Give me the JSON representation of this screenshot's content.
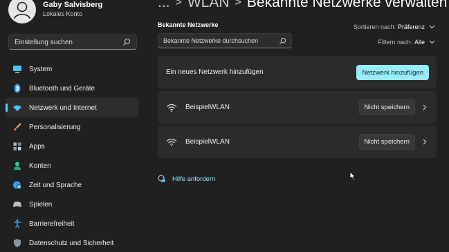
{
  "profile": {
    "name": "Gaby Salvisberg",
    "account_type": "Lokales Konto"
  },
  "sidebar": {
    "search_text": "Einstellung suchen",
    "items": [
      {
        "label": "System",
        "icon": "monitor-icon"
      },
      {
        "label": "Bluetooth und Geräte",
        "icon": "bluetooth-icon"
      },
      {
        "label": "Netzwerk und Internet",
        "icon": "wifi-network-icon",
        "active": true
      },
      {
        "label": "Personalisierung",
        "icon": "brush-icon"
      },
      {
        "label": "Apps",
        "icon": "apps-icon"
      },
      {
        "label": "Konten",
        "icon": "person-icon"
      },
      {
        "label": "Zeit und Sprache",
        "icon": "globe-clock-icon"
      },
      {
        "label": "Spielen",
        "icon": "gamepad-icon"
      },
      {
        "label": "Barrierefreiheit",
        "icon": "accessibility-icon"
      },
      {
        "label": "Datenschutz und Sicherheit",
        "icon": "shield-icon"
      }
    ]
  },
  "header": {
    "breadcrumb_1": "WLAN",
    "breadcrumb_2": "Bekannte Netzwerke verwalten",
    "separator": ">"
  },
  "main": {
    "section_label": "Bekannte Netzwerke",
    "search_text": "Bekannte Netzwerke durchsuchen",
    "sort_label": "Sortieren nach:",
    "sort_value": "Präferenz",
    "filter_label": "Filtern nach:",
    "filter_value": "Alle",
    "add_network_text": "Ein neues Netzwerk hinzufügen",
    "add_network_button": "Netzwerk hinzufügen",
    "networks": [
      {
        "name": "BeispielWLAN",
        "forget_button": "Nicht speichern"
      },
      {
        "name": "BeispielWLAN",
        "forget_button": "Nicht speichern"
      }
    ],
    "help_link": "Hilfe anfordern"
  },
  "colors": {
    "background": "#202020",
    "card": "#2b2b2b",
    "accent": "#99ebff",
    "nav_indicator": "#60cdff"
  }
}
